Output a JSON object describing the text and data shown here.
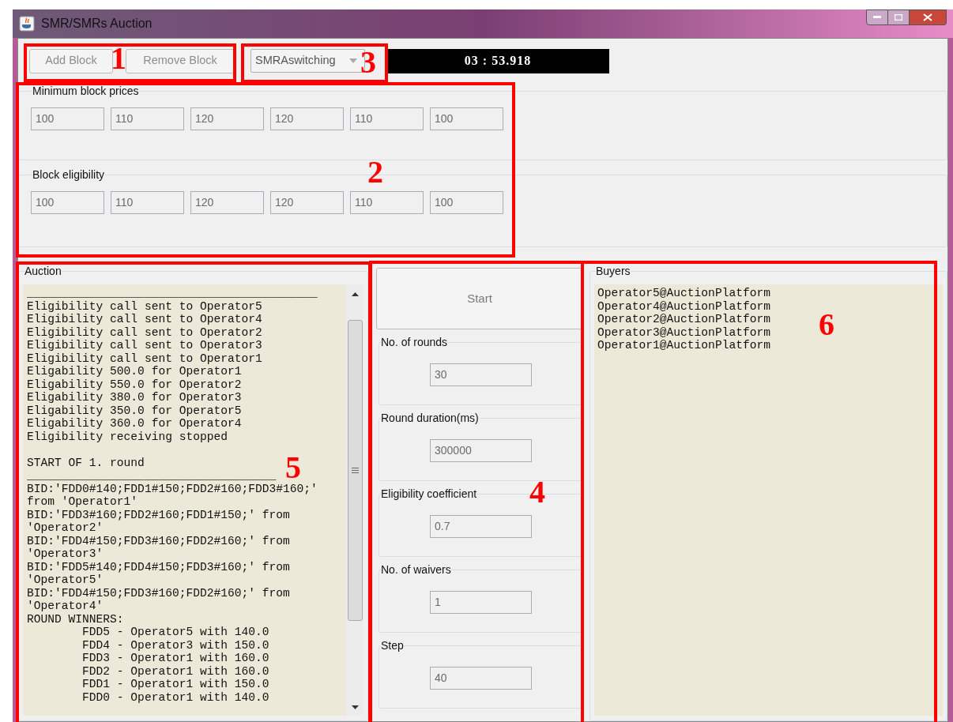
{
  "window": {
    "title": "SMR/SMRs Auction"
  },
  "toolbar": {
    "buttons": [
      {
        "label": "Add Block",
        "disabled": true
      },
      {
        "label": "Remove Block",
        "disabled": true
      }
    ],
    "mode_select": {
      "value": "SMRAswitching"
    },
    "timer": "03 : 53.918"
  },
  "minimum_block_prices": {
    "title": "Minimum block prices",
    "values": [
      "100",
      "110",
      "120",
      "120",
      "110",
      "100"
    ]
  },
  "block_eligibility": {
    "title": "Block eligibility",
    "values": [
      "100",
      "110",
      "120",
      "120",
      "110",
      "100"
    ]
  },
  "auction": {
    "title": "Auction",
    "log_sections": [
      [
        "__________________________________________",
        "Eligibility call sent to Operator5",
        "Eligibility call sent to Operator4",
        "Eligibility call sent to Operator2",
        "Eligibility call sent to Operator3",
        "Eligibility call sent to Operator1",
        "Eligability 500.0 for Operator1",
        "Eligability 550.0 for Operator2",
        "Eligability 380.0 for Operator3",
        "Eligability 350.0 for Operator5",
        "Eligability 360.0 for Operator4",
        "Eligibility receiving stopped"
      ],
      [
        "START OF 1. round",
        "____________________________________",
        "BID:'FDD0#140;FDD1#150;FDD2#160;FDD3#160;'",
        "from 'Operator1'",
        "BID:'FDD3#160;FDD2#160;FDD1#150;' from",
        "'Operator2'",
        "BID:'FDD4#150;FDD3#160;FDD2#160;' from",
        "'Operator3'",
        "BID:'FDD5#140;FDD4#150;FDD3#160;' from",
        "'Operator5'",
        "BID:'FDD4#150;FDD3#160;FDD2#160;' from",
        "'Operator4'",
        "ROUND WINNERS:",
        "        FDD5 - Operator5 with 140.0",
        "        FDD4 - Operator3 with 150.0",
        "        FDD3 - Operator1 with 160.0",
        "        FDD2 - Operator1 with 160.0",
        "        FDD1 - Operator1 with 150.0",
        "        FDD0 - Operator1 with 140.0"
      ]
    ]
  },
  "settings": {
    "start_button": {
      "label": "Start",
      "disabled": true
    },
    "fields": [
      {
        "label": "No. of rounds",
        "value": "30",
        "disabled": true
      },
      {
        "label": "Round duration(ms)",
        "value": "300000",
        "disabled": true
      },
      {
        "label": "Eligibility coefficient",
        "value": "0.7",
        "disabled": true
      },
      {
        "label": "No. of waivers",
        "value": "1",
        "disabled": true
      },
      {
        "label": "Step",
        "value": "40",
        "disabled": true
      }
    ]
  },
  "buyers": {
    "title": "Buyers",
    "items": [
      "Operator5@AuctionPlatform",
      "Operator4@AuctionPlatform",
      "Operator2@AuctionPlatform",
      "Operator3@AuctionPlatform",
      "Operator1@AuctionPlatform"
    ]
  },
  "annotations": [
    {
      "label": "1"
    },
    {
      "label": "2"
    },
    {
      "label": "3"
    },
    {
      "label": "4"
    },
    {
      "label": "5"
    },
    {
      "label": "6"
    }
  ]
}
